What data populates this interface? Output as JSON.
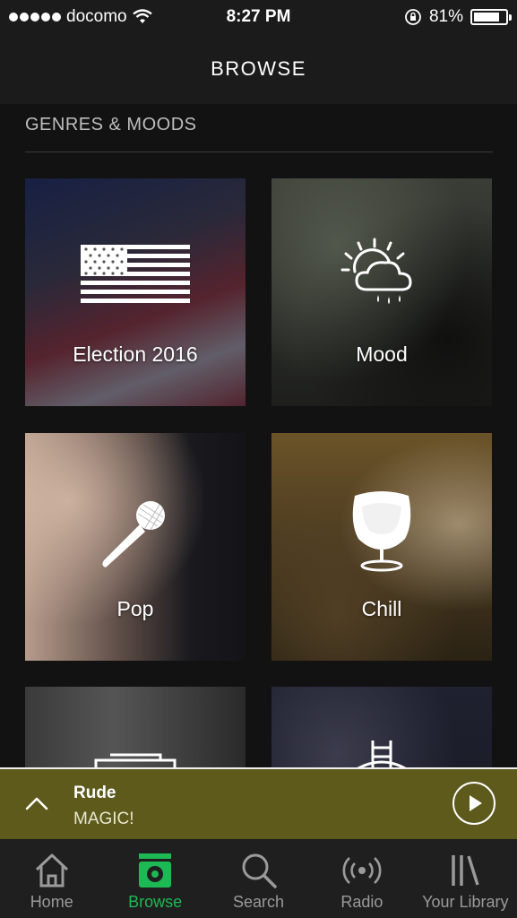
{
  "status_bar": {
    "carrier": "docomo",
    "time": "8:27 PM",
    "battery_percent": "81%",
    "battery_level": 0.81,
    "icons": [
      "signal-dots-icon",
      "wifi-icon",
      "rotation-lock-icon",
      "battery-icon"
    ]
  },
  "header": {
    "title": "BROWSE"
  },
  "section": {
    "title": "GENRES & MOODS"
  },
  "tiles": [
    {
      "label": "Election 2016",
      "icon": "us-flag-icon"
    },
    {
      "label": "Mood",
      "icon": "weather-icon"
    },
    {
      "label": "Pop",
      "icon": "microphone-icon"
    },
    {
      "label": "Chill",
      "icon": "egg-chair-icon"
    },
    {
      "label": "",
      "icon": "boombox-icon"
    },
    {
      "label": "",
      "icon": "stage-icon"
    }
  ],
  "now_playing": {
    "title": "Rude",
    "artist": "MAGIC!",
    "icons": [
      "chevron-up-icon",
      "play-icon"
    ]
  },
  "tab_bar": {
    "items": [
      {
        "label": "Home",
        "icon": "home-icon",
        "active": false
      },
      {
        "label": "Browse",
        "icon": "browse-icon",
        "active": true
      },
      {
        "label": "Search",
        "icon": "search-icon",
        "active": false
      },
      {
        "label": "Radio",
        "icon": "radio-icon",
        "active": false
      },
      {
        "label": "Your Library",
        "icon": "library-icon",
        "active": false
      }
    ]
  },
  "colors": {
    "accent": "#1db954",
    "now_playing_bg": "#5d5a1c",
    "background": "#121212"
  }
}
